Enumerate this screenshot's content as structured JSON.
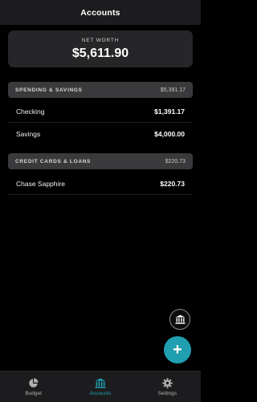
{
  "header": {
    "title": "Accounts"
  },
  "networth": {
    "label": "NET WORTH",
    "value": "$5,611.90"
  },
  "sections": [
    {
      "title": "SPENDING & SAVINGS",
      "total": "$5,391.17",
      "accounts": [
        {
          "name": "Checking",
          "balance": "$1,391.17"
        },
        {
          "name": "Savings",
          "balance": "$4,000.00"
        }
      ]
    },
    {
      "title": "CREDIT CARDS & LOANS",
      "total": "$220.73",
      "accounts": [
        {
          "name": "Chase Sapphire",
          "balance": "$220.73"
        }
      ]
    }
  ],
  "tabs": [
    {
      "label": "Budget",
      "icon": "pie-chart-icon"
    },
    {
      "label": "Accounts",
      "icon": "bank-icon"
    },
    {
      "label": "Settings",
      "icon": "gear-icon"
    }
  ],
  "fab": {
    "label": "+"
  },
  "colors": {
    "accent": "#1f9fb0",
    "background": "#000000",
    "card": "#262628",
    "section_header": "#3a3a3c"
  }
}
